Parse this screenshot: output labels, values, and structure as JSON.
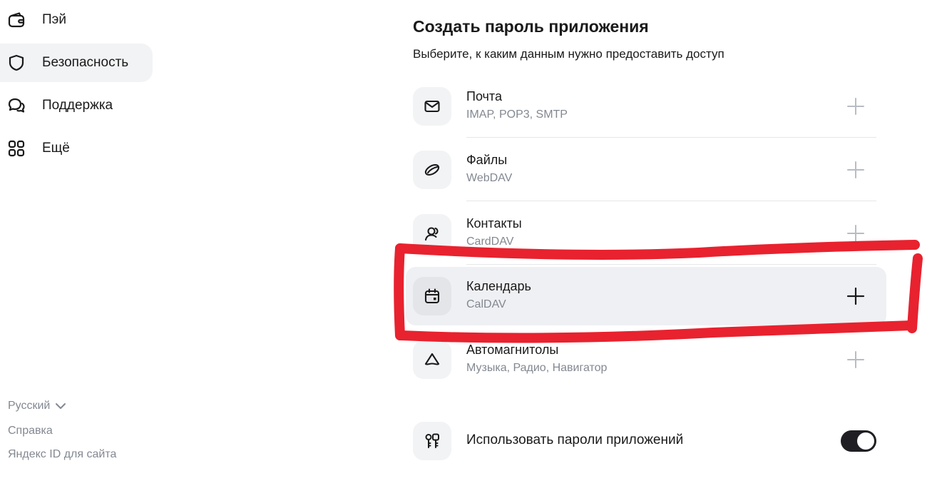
{
  "sidebar": {
    "items": [
      {
        "label": "Пэй",
        "icon": "wallet-icon",
        "active": false
      },
      {
        "label": "Безопасность",
        "icon": "shield-icon",
        "active": true
      },
      {
        "label": "Поддержка",
        "icon": "chat-bubbles-icon",
        "active": false
      },
      {
        "label": "Ещё",
        "icon": "grid-icon",
        "active": false
      }
    ],
    "footer": {
      "language": "Русский",
      "help": "Справка",
      "yandex_id_for_site": "Яндекс ID для сайта"
    }
  },
  "main": {
    "title": "Создать пароль приложения",
    "subtitle": "Выберите, к каким данным нужно предоставить доступ",
    "services": [
      {
        "name": "Почта",
        "protocols": "IMAP, POP3, SMTP",
        "icon": "mail-icon"
      },
      {
        "name": "Файлы",
        "protocols": "WebDAV",
        "icon": "disk-icon"
      },
      {
        "name": "Контакты",
        "protocols": "CardDAV",
        "icon": "contacts-icon"
      },
      {
        "name": "Календарь",
        "protocols": "CalDAV",
        "icon": "calendar-icon",
        "highlighted": true
      },
      {
        "name": "Автомагнитолы",
        "protocols": "Музыка, Радио, Навигатор",
        "icon": "car-icon"
      }
    ],
    "app_passwords_toggle": {
      "label": "Использовать пароли приложений",
      "on": true
    }
  },
  "colors": {
    "muted_text": "#838891",
    "icon_bg": "#f2f3f5",
    "toggle_on": "#1f1f23",
    "annotation": "#e8222f"
  }
}
